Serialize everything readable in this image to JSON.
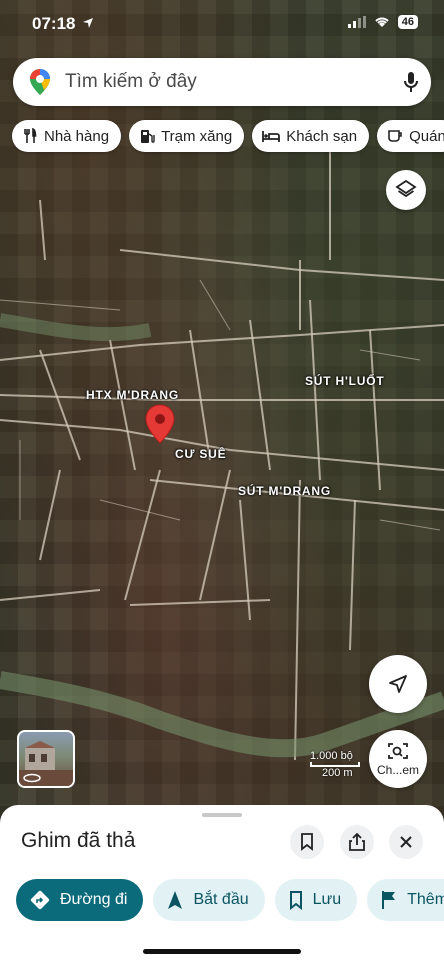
{
  "status_bar": {
    "time": "07:18",
    "battery": "46"
  },
  "search": {
    "placeholder": "Tìm kiếm ở đây"
  },
  "chips": [
    {
      "label": "Nhà hàng",
      "icon": "restaurant-icon"
    },
    {
      "label": "Trạm xăng",
      "icon": "gas-station-icon"
    },
    {
      "label": "Khách sạn",
      "icon": "hotel-icon"
    },
    {
      "label": "Quán",
      "icon": "cafe-icon"
    }
  ],
  "map": {
    "labels": {
      "htx": "HTX M'DRANG",
      "sut_hluot": "SÚT H'LUỐT",
      "cu_sue": "CƯ SUÊ",
      "sut_mdrang": "SÚT M'DRANG"
    },
    "pin_color": "#e53935",
    "scale": {
      "imperial": "1.000 bộ",
      "metric": "200 m"
    }
  },
  "streetview": {
    "label": "Ch...em"
  },
  "sheet": {
    "title": "Ghim đã thả",
    "actions": [
      {
        "label": "Đường đi",
        "icon": "directions-icon"
      },
      {
        "label": "Bắt đầu",
        "icon": "navigation-icon"
      },
      {
        "label": "Lưu",
        "icon": "bookmark-icon"
      },
      {
        "label": "Thêm",
        "icon": "flag-icon"
      }
    ]
  },
  "colors": {
    "accent": "#0b6b7a",
    "accent_light": "#e1f1f4"
  }
}
